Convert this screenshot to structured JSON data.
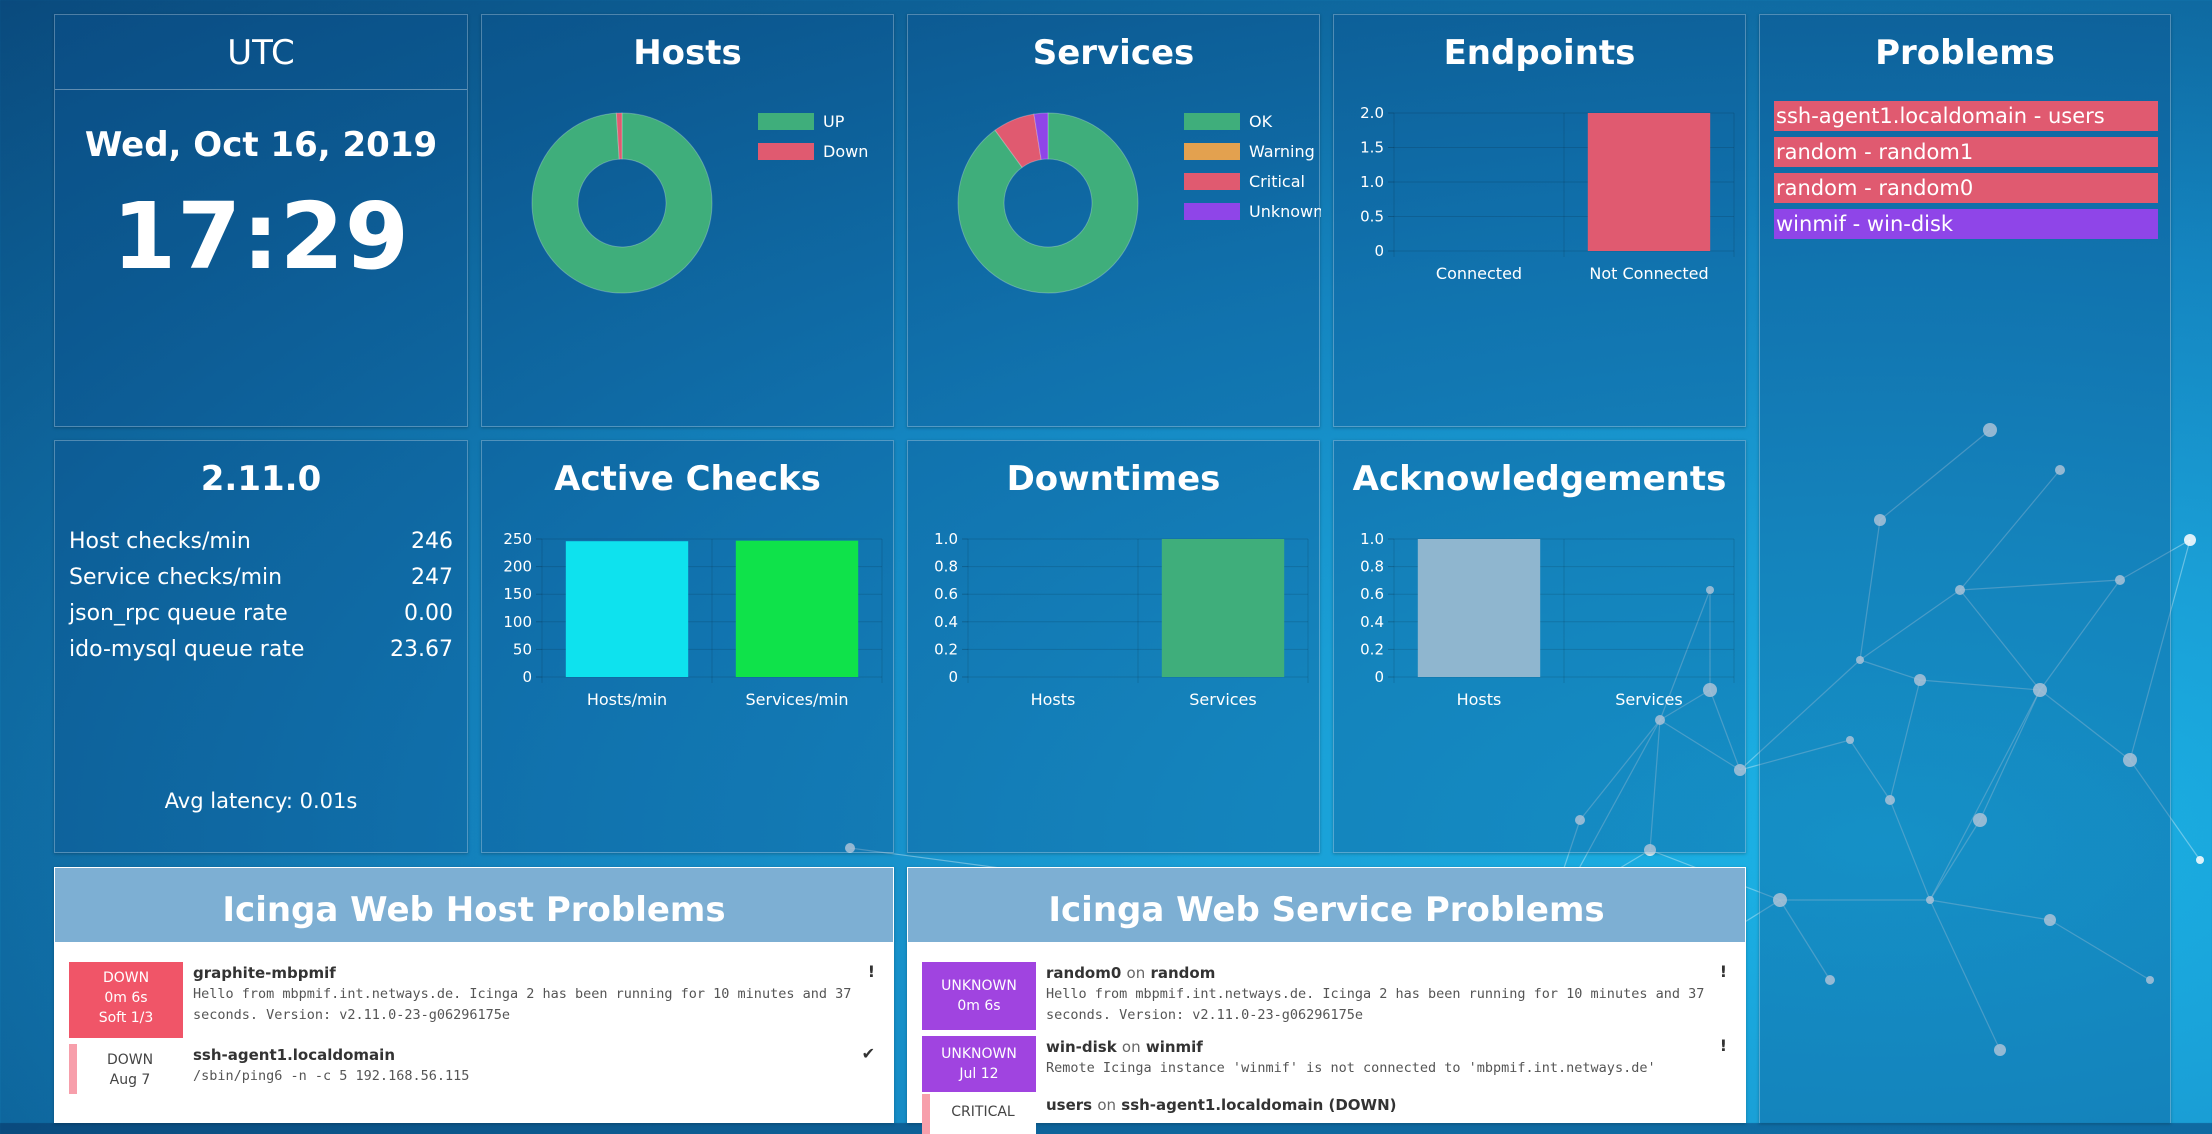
{
  "clock": {
    "title": "UTC",
    "date": "Wed, Oct 16, 2019",
    "time": "17:29"
  },
  "version": {
    "title": "2.11.0",
    "stats": [
      {
        "label": "Host checks/min",
        "value": "246"
      },
      {
        "label": "Service checks/min",
        "value": "247"
      },
      {
        "label": "json_rpc queue rate",
        "value": "0.00"
      },
      {
        "label": "ido-mysql queue rate",
        "value": "23.67"
      }
    ],
    "latency": "Avg latency: 0.01s"
  },
  "hosts": {
    "title": "Hosts",
    "chart_data": {
      "type": "pie",
      "donut": true,
      "labels": [
        "UP",
        "Down"
      ],
      "values": [
        99,
        1
      ],
      "colors": [
        "#3fae7b",
        "#e05a70"
      ]
    }
  },
  "services": {
    "title": "Services",
    "chart_data": {
      "type": "pie",
      "donut": true,
      "labels": [
        "OK",
        "Warning",
        "Critical",
        "Unknown"
      ],
      "values": [
        90,
        0,
        7.5,
        2.5
      ],
      "colors": [
        "#3fae7b",
        "#e3a14f",
        "#e05a70",
        "#8f45e8"
      ]
    }
  },
  "endpoints": {
    "title": "Endpoints",
    "chart_data": {
      "type": "bar",
      "categories": [
        "Connected",
        "Not Connected"
      ],
      "values": [
        0,
        2
      ],
      "colors": [
        "#e05a70",
        "#e05a70"
      ],
      "ylim": [
        0,
        2
      ],
      "yticks": [
        "2.0",
        "1.5",
        "1.0",
        "0.5",
        "0"
      ],
      "tickvals": [
        2,
        1.5,
        1,
        0.5,
        0
      ]
    }
  },
  "active_checks": {
    "title": "Active Checks",
    "chart_data": {
      "type": "bar",
      "categories": [
        "Hosts/min",
        "Services/min"
      ],
      "values": [
        246,
        247
      ],
      "colors": [
        "#0ee2ee",
        "#0fe24a"
      ],
      "ylim": [
        0,
        250
      ],
      "yticks": [
        "250",
        "200",
        "150",
        "100",
        "50",
        "0"
      ],
      "tickvals": [
        250,
        200,
        150,
        100,
        50,
        0
      ]
    }
  },
  "downtimes": {
    "title": "Downtimes",
    "chart_data": {
      "type": "bar",
      "categories": [
        "Hosts",
        "Services"
      ],
      "values": [
        0,
        1
      ],
      "colors": [
        "#3fae7b",
        "#3fae7b"
      ],
      "ylim": [
        0,
        1
      ],
      "yticks": [
        "1.0",
        "0.8",
        "0.6",
        "0.4",
        "0.2",
        "0"
      ],
      "tickvals": [
        1,
        0.8,
        0.6,
        0.4,
        0.2,
        0
      ]
    }
  },
  "acknowledgements": {
    "title": "Acknowledgements",
    "chart_data": {
      "type": "bar",
      "categories": [
        "Hosts",
        "Services"
      ],
      "values": [
        1,
        0
      ],
      "colors": [
        "#8fb6cf",
        "#8fb6cf"
      ],
      "ylim": [
        0,
        1
      ],
      "yticks": [
        "1.0",
        "0.8",
        "0.6",
        "0.4",
        "0.2",
        "0"
      ],
      "tickvals": [
        1,
        0.8,
        0.6,
        0.4,
        0.2,
        0
      ]
    }
  },
  "problems": {
    "title": "Problems",
    "items": [
      {
        "label": "ssh-agent1.localdomain - users",
        "color": "#e05a70"
      },
      {
        "label": "random - random1",
        "color": "#e05a70"
      },
      {
        "label": "random - random0",
        "color": "#e05a70"
      },
      {
        "label": "winmif - win-disk",
        "color": "#8f45e8"
      }
    ]
  },
  "host_problems": {
    "title": "Icinga Web Host Problems",
    "rows": [
      {
        "state": "DOWN",
        "line2": "0m 6s",
        "line3": "Soft 1/3",
        "name": "graphite-mbpmif",
        "output": "Hello from mbpmif.int.netways.de. Icinga 2 has been running for 10 minutes and 37 seconds. Version: v2.11.0-23-g06296175e",
        "mark": "!"
      },
      {
        "state": "DOWN",
        "line2": "Aug 7",
        "name": "ssh-agent1.localdomain",
        "output": "/sbin/ping6 -n -c 5 192.168.56.115",
        "mark": "✔"
      }
    ]
  },
  "service_problems": {
    "title": "Icinga Web Service Problems",
    "on": "on",
    "rows": [
      {
        "state": "UNKNOWN",
        "line2": "0m 6s",
        "service": "random0",
        "host": "random",
        "output": "Hello from mbpmif.int.netways.de. Icinga 2 has been running for 10 minutes and 37 seconds. Version: v2.11.0-23-g06296175e",
        "mark": "!"
      },
      {
        "state": "UNKNOWN",
        "line2": "Jul 12",
        "service": "win-disk",
        "host": "winmif",
        "output": "Remote Icinga instance 'winmif' is not connected to 'mbpmif.int.netways.de'",
        "mark": "!"
      },
      {
        "state": "CRITICAL",
        "service": "users",
        "host": "ssh-agent1.localdomain (DOWN)"
      }
    ]
  }
}
